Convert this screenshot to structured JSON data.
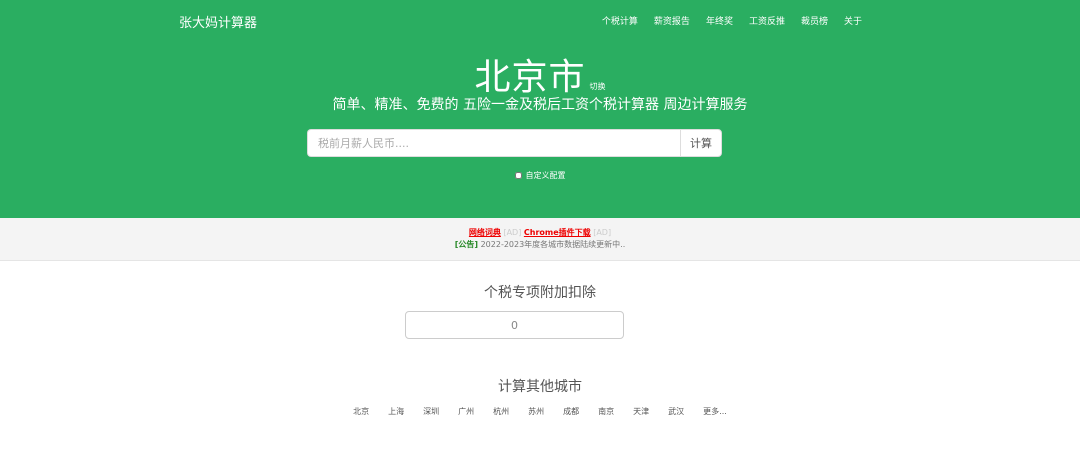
{
  "header": {
    "brand": "张大妈计算器",
    "nav": [
      "个税计算",
      "薪资报告",
      "年终奖",
      "工资反推",
      "裁员榜",
      "关于"
    ]
  },
  "hero": {
    "city": "北京市",
    "switch_label": "切换",
    "tagline": "简单、精准、免费的 五险一金及税后工资个税计算器 周边计算服务",
    "search_placeholder": "税前月薪人民币....",
    "search_button": "计算",
    "custom_label": "自定义配置"
  },
  "notice": {
    "ad1_text": "网络词典",
    "ad_tag": "[AD]",
    "ad2_text": "Chrome插件下载",
    "notice_tag": "[公告]",
    "notice_text": "2022-2023年度各城市数据陆续更新中.."
  },
  "deduction": {
    "title": "个税专项附加扣除",
    "value": "0"
  },
  "other_cities": {
    "title": "计算其他城市",
    "cities": [
      "北京",
      "上海",
      "深圳",
      "广州",
      "杭州",
      "苏州",
      "成都",
      "南京",
      "天津",
      "武汉",
      "更多..."
    ]
  },
  "colors": {
    "brand_green": "#2aae61",
    "ad_red": "#ee0000",
    "notice_green": "#2a8a2a"
  }
}
